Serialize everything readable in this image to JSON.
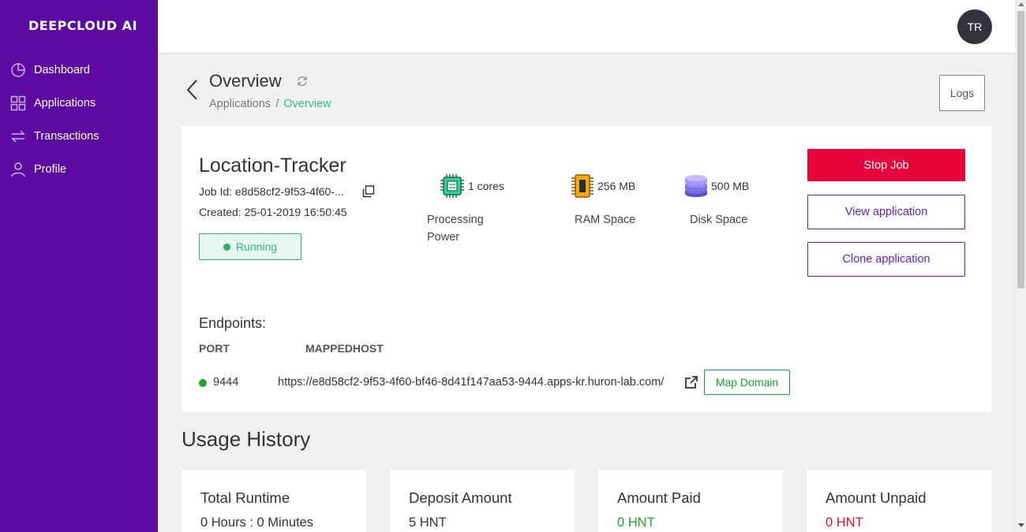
{
  "sidebar": {
    "logo": "DEEPCLOUD AI",
    "items": [
      {
        "label": "Dashboard",
        "icon": "pie-chart-icon"
      },
      {
        "label": "Applications",
        "icon": "grid-icon"
      },
      {
        "label": "Transactions",
        "icon": "swap-arrows-icon"
      },
      {
        "label": "Profile",
        "icon": "user-icon"
      }
    ]
  },
  "topbar": {
    "avatar_initials": "TR"
  },
  "header": {
    "title": "Overview",
    "breadcrumb": [
      "Applications",
      "Overview"
    ],
    "breadcrumb_sep": "/",
    "logs_label": "Logs"
  },
  "app": {
    "name": "Location-Tracker",
    "job_id": "Job Id: e8d58cf2-9f53-4f60-...",
    "created": "Created: 25-01-2019 16:50:45",
    "status": "Running",
    "status_color": "#36b37e"
  },
  "specs": [
    {
      "value": "1 cores",
      "label": "Processing Power",
      "icon": "cpu-icon"
    },
    {
      "value": "256 MB",
      "label": "RAM Space",
      "icon": "ram-icon"
    },
    {
      "value": "500 MB",
      "label": "Disk Space",
      "icon": "disk-icon"
    }
  ],
  "actions": {
    "stop": "Stop Job",
    "view": "View application",
    "clone": "Clone application",
    "stop_color": "#e6063b",
    "accent": "#6e1ac7"
  },
  "endpoints": {
    "title": "Endpoints:",
    "col_port": "PORT",
    "col_host": "MAPPEDHOST",
    "rows": [
      {
        "port": "9444",
        "host": "https://e8d58cf2-9f53-4f60-bf46-8d41f147aa53-9444.apps-kr.huron-lab.com/",
        "action": "Map Domain"
      }
    ]
  },
  "usage": {
    "title": "Usage History",
    "stats": [
      {
        "title": "Total Runtime",
        "value": "0 Hours : 0 Minutes"
      },
      {
        "title": "Deposit Amount",
        "value": "5 HNT"
      },
      {
        "title": "Amount Paid",
        "value": "0 HNT"
      },
      {
        "title": "Amount Unpaid",
        "value": "0 HNT"
      }
    ]
  },
  "colors": {
    "sidebar": "#5d0aa3",
    "running_green": "#1aa32d",
    "unpaid_red": "#e60d20"
  }
}
